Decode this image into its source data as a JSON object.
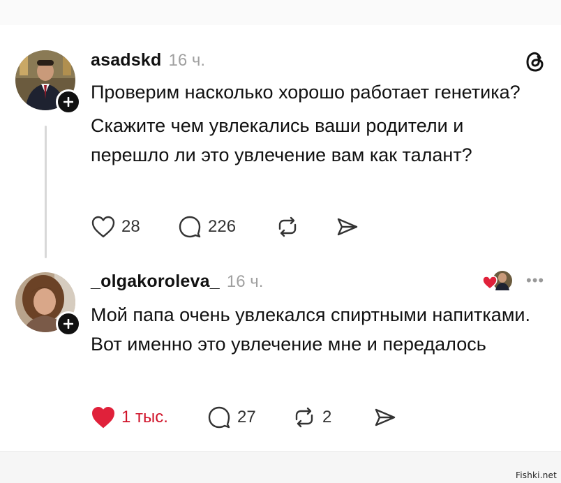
{
  "post1": {
    "username": "asadskd",
    "time": "16 ч.",
    "paragraphs": [
      "Проверим насколько хорошо работает генетика?",
      "Скажите чем увлекались ваши родители и перешло ли это увлечение вам как талант?"
    ],
    "likes": "28",
    "replies": "226",
    "icons": {
      "logo": "threads-logo-icon",
      "like": "heart-outline-icon",
      "reply": "speech-bubble-icon",
      "repost": "repost-icon",
      "share": "send-icon"
    }
  },
  "post2": {
    "username": "_olgakoroleva_",
    "time": "16 ч.",
    "text": "Мой папа очень увлекался спиртными напитками. Вот именно это увлечение мне и передалось",
    "likes": "1 тыс.",
    "replies": "27",
    "reposts": "2",
    "icons": {
      "like": "heart-filled-icon",
      "reply": "speech-bubble-icon",
      "repost": "repost-icon",
      "share": "send-icon",
      "more": "more-dots-icon"
    }
  },
  "watermark": "Fishki.net",
  "colors": {
    "like_active": "#e0213a",
    "text": "#111111",
    "muted": "#a0a0a0",
    "thread_line": "#d8d8d8"
  }
}
